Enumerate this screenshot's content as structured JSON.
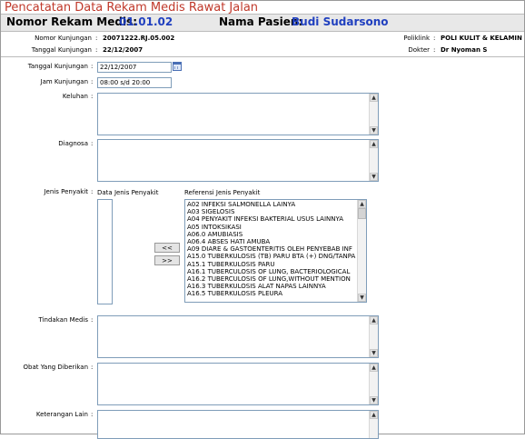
{
  "title": "Pencatatan Data Rekam Medis Rawat Jalan",
  "header": {
    "nomor_label": "Nomor Rekam Medis:",
    "nomor_value": "01.01.02",
    "pasien_label": "Nama Pasien:",
    "pasien_value": "Budi Sudarsono"
  },
  "info": {
    "nomor_kunjungan_label": "Nomor Kunjungan",
    "nomor_kunjungan_value": "20071222.RJ.05.002",
    "tanggal_kunjungan_label": "Tanggal Kunjungan",
    "tanggal_kunjungan_value": "22/12/2007",
    "poliklinik_label": "Poliklink",
    "poliklinik_value": "POLI KULIT & KELAMIN",
    "dokter_label": "Dokter",
    "dokter_value": "Dr Nyoman S"
  },
  "form": {
    "tanggal_label": "Tanggal Kunjungan",
    "tanggal_value": "22/12/2007",
    "jam_label": "Jam Kunjungan",
    "jam_value": "08:00 s/d 20:00",
    "keluhan_label": "Keluhan",
    "diagnosa_label": "Diagnosa",
    "jenis_label": "Jenis Penyakit",
    "data_jenis_label": "Data Jenis Penyakit",
    "referensi_label": "Referensi Jenis Penyakit",
    "btn_left": "<<",
    "btn_right": ">>",
    "tindakan_label": "Tindakan Medis",
    "obat_label": "Obat Yang Diberikan",
    "keterangan_label": "Keterangan Lain"
  },
  "referensi_items": [
    "A02 INFEKSI SALMONELLA LAINYA",
    "A03 SIGELOSIS",
    "A04 PENYAKIT INFEKSI BAKTERIAL USUS LAINNYA",
    "A05 INTOKSIKASI",
    "A06.0 AMUBIASIS",
    "A06.4 ABSES HATI AMUBA",
    "A09 DIARE & GASTOENTERITIS OLEH PENYEBAB INF",
    "A15.0 TUBERKULOSIS (TB) PARU BTA (+) DNG/TANPA",
    "A15.1 TUBERKULOSIS PARU",
    "A16.1 TUBERCULOSIS OF LUNG, BACTERIOLOGICAL",
    "A16.2 TUBERCULOSIS OF LUNG,WITHOUT MENTION",
    "A16.3 TUBERKULOSIS ALAT NAPAS LAINNYA",
    "A16.5 TUBERKULOSIS PLEURA"
  ],
  "colors": {
    "title": "#c0392b",
    "header_value": "#1f3fbf"
  }
}
